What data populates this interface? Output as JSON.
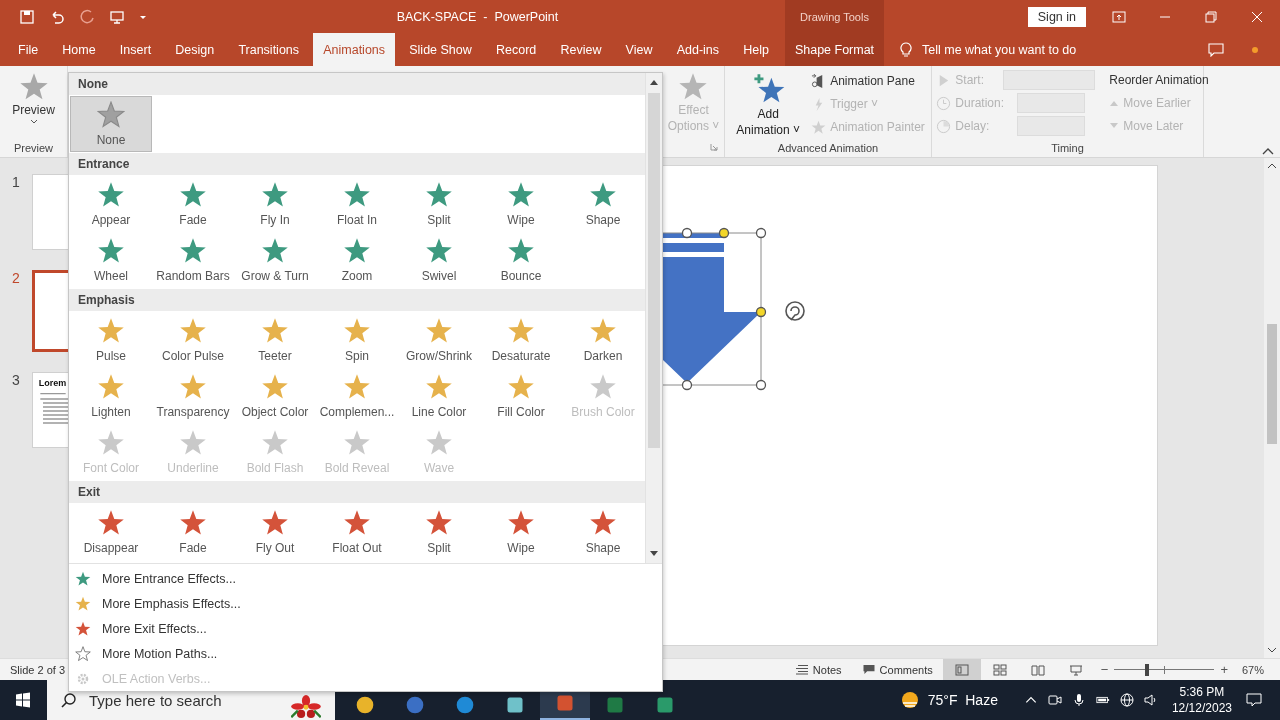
{
  "title_bar": {
    "title": "BACK-SPACE  -  PowerPoint",
    "context_label": "Drawing Tools",
    "sign_in": "Sign in"
  },
  "tabs": [
    {
      "label": "File",
      "selected": false
    },
    {
      "label": "Home",
      "selected": false
    },
    {
      "label": "Insert",
      "selected": false
    },
    {
      "label": "Design",
      "selected": false
    },
    {
      "label": "Transitions",
      "selected": false
    },
    {
      "label": "Animations",
      "selected": true
    },
    {
      "label": "Slide Show",
      "selected": false
    },
    {
      "label": "Record",
      "selected": false
    },
    {
      "label": "Review",
      "selected": false
    },
    {
      "label": "View",
      "selected": false
    },
    {
      "label": "Add-ins",
      "selected": false
    },
    {
      "label": "Help",
      "selected": false
    }
  ],
  "context_tab": {
    "label": "Shape Format",
    "selected": false
  },
  "tell_me": "Tell me what you want to do",
  "ribbon": {
    "preview": {
      "label": "Preview",
      "group": "Preview"
    },
    "effect_options": {
      "line1": "Effect",
      "line2": "Options ˅",
      "disabled": true
    },
    "add_animation": {
      "line1": "Add",
      "line2": "Animation ˅"
    },
    "animation_pane": "Animation Pane",
    "trigger": {
      "label": "Trigger ˅",
      "disabled": true
    },
    "animation_painter": {
      "label": "Animation Painter",
      "disabled": true
    },
    "advanced_group": "Advanced Animation",
    "timing": [
      {
        "kind": "start",
        "label": "Start:",
        "disabled": true
      },
      {
        "kind": "duration",
        "label": "Duration:",
        "disabled": true
      },
      {
        "kind": "delay",
        "label": "Delay:",
        "disabled": true
      }
    ],
    "reorder": "Reorder Animation",
    "move_earlier": {
      "label": "Move Earlier",
      "disabled": true
    },
    "move_later": {
      "label": "Move Later",
      "disabled": true
    },
    "timing_group": "Timing"
  },
  "slides": [
    {
      "number": "1",
      "selected": false
    },
    {
      "number": "2",
      "selected": true
    },
    {
      "number": "3",
      "selected": false,
      "title": "Lorem"
    }
  ],
  "gallery": {
    "sections": [
      {
        "kind": "none",
        "header": "None",
        "items": [
          {
            "label": "None",
            "selected": true,
            "disabled": false
          }
        ]
      },
      {
        "kind": "entrance",
        "header": "Entrance",
        "items": [
          {
            "label": "Appear",
            "selected": false,
            "disabled": false
          },
          {
            "label": "Fade",
            "selected": false,
            "disabled": false
          },
          {
            "label": "Fly In",
            "selected": false,
            "disabled": false
          },
          {
            "label": "Float In",
            "selected": false,
            "disabled": false
          },
          {
            "label": "Split",
            "selected": false,
            "disabled": false
          },
          {
            "label": "Wipe",
            "selected": false,
            "disabled": false
          },
          {
            "label": "Shape",
            "selected": false,
            "disabled": false
          },
          {
            "label": "Wheel",
            "selected": false,
            "disabled": false
          },
          {
            "label": "Random Bars",
            "selected": false,
            "disabled": false
          },
          {
            "label": "Grow & Turn",
            "selected": false,
            "disabled": false
          },
          {
            "label": "Zoom",
            "selected": false,
            "disabled": false
          },
          {
            "label": "Swivel",
            "selected": false,
            "disabled": false
          },
          {
            "label": "Bounce",
            "selected": false,
            "disabled": false
          }
        ]
      },
      {
        "kind": "emphasis",
        "header": "Emphasis",
        "items": [
          {
            "label": "Pulse",
            "selected": false,
            "disabled": false
          },
          {
            "label": "Color Pulse",
            "selected": false,
            "disabled": false
          },
          {
            "label": "Teeter",
            "selected": false,
            "disabled": false
          },
          {
            "label": "Spin",
            "selected": false,
            "disabled": false
          },
          {
            "label": "Grow/Shrink",
            "selected": false,
            "disabled": false
          },
          {
            "label": "Desaturate",
            "selected": false,
            "disabled": false
          },
          {
            "label": "Darken",
            "selected": false,
            "disabled": false
          },
          {
            "label": "Lighten",
            "selected": false,
            "disabled": false
          },
          {
            "label": "Transparency",
            "selected": false,
            "disabled": false
          },
          {
            "label": "Object Color",
            "selected": false,
            "disabled": false
          },
          {
            "label": "Complemen...",
            "selected": false,
            "disabled": false
          },
          {
            "label": "Line Color",
            "selected": false,
            "disabled": false
          },
          {
            "label": "Fill Color",
            "selected": false,
            "disabled": false
          },
          {
            "label": "Brush Color",
            "selected": false,
            "disabled": true
          },
          {
            "label": "Font Color",
            "selected": false,
            "disabled": true
          },
          {
            "label": "Underline",
            "selected": false,
            "disabled": true
          },
          {
            "label": "Bold Flash",
            "selected": false,
            "disabled": true
          },
          {
            "label": "Bold Reveal",
            "selected": false,
            "disabled": true
          },
          {
            "label": "Wave",
            "selected": false,
            "disabled": true
          }
        ]
      },
      {
        "kind": "exit",
        "header": "Exit",
        "items": [
          {
            "label": "Disappear",
            "selected": false,
            "disabled": false
          },
          {
            "label": "Fade",
            "selected": false,
            "disabled": false
          },
          {
            "label": "Fly Out",
            "selected": false,
            "disabled": false
          },
          {
            "label": "Float Out",
            "selected": false,
            "disabled": false
          },
          {
            "label": "Split",
            "selected": false,
            "disabled": false
          },
          {
            "label": "Wipe",
            "selected": false,
            "disabled": false
          },
          {
            "label": "Shape",
            "selected": false,
            "disabled": false
          }
        ]
      }
    ],
    "commands": [
      {
        "kind": "entrance",
        "label": "More Entrance Effects...",
        "disabled": false
      },
      {
        "kind": "emphasis",
        "label": "More Emphasis Effects...",
        "disabled": false
      },
      {
        "kind": "exit",
        "label": "More Exit Effects...",
        "disabled": false
      },
      {
        "kind": "motion",
        "label": "More Motion Paths...",
        "disabled": false
      },
      {
        "kind": "ole",
        "label": "OLE Action Verbs...",
        "disabled": true
      }
    ]
  },
  "status_bar": {
    "slide": "Slide 2 of 3",
    "notes": "Notes",
    "comments": "Comments",
    "views": [
      {
        "kind": "normal",
        "selected": true
      },
      {
        "kind": "sorter",
        "selected": false
      },
      {
        "kind": "reading",
        "selected": false
      },
      {
        "kind": "show",
        "selected": false
      }
    ],
    "zoom_out": "−",
    "zoom_in": "+",
    "zoom": {
      "level": 0.33
    },
    "zoom_label": "67%"
  },
  "taskbar": {
    "search_placeholder": "Type here to search",
    "apps": [
      {
        "kind": "chrome",
        "selected": false
      },
      {
        "kind": "pen",
        "selected": false
      },
      {
        "kind": "edge",
        "selected": false
      },
      {
        "kind": "files",
        "selected": false
      },
      {
        "kind": "powerpoint",
        "selected": true
      },
      {
        "kind": "excel",
        "selected": false
      },
      {
        "kind": "snip",
        "selected": false
      }
    ],
    "weather": "75°F  Haze",
    "time": "5:36 PM",
    "date": "12/12/2023"
  }
}
